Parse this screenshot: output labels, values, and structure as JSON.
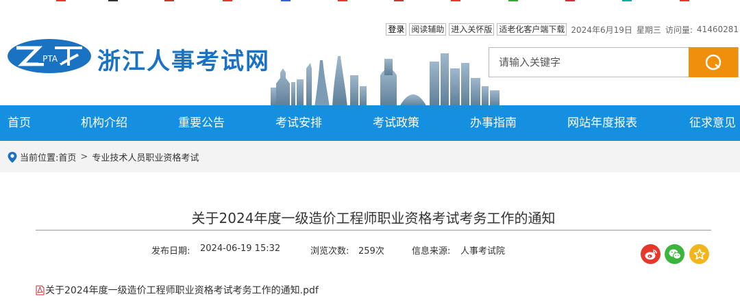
{
  "site": {
    "logo_text": "PTA",
    "title": "浙江人事考试网"
  },
  "toplinks": {
    "login": "登录",
    "reading_aid": "阅读辅助",
    "care_mode": "进入关怀版",
    "elderly_download": "适老化客户端下载",
    "date": "2024年6月19日",
    "weekday": "星期三",
    "visits_label": "访问量:",
    "visits": "41460281"
  },
  "search": {
    "placeholder": "请输入关键字",
    "icon": "search-icon"
  },
  "nav": {
    "items": [
      {
        "label": "首页"
      },
      {
        "label": "机构介绍"
      },
      {
        "label": "重要公告"
      },
      {
        "label": "考试安排"
      },
      {
        "label": "考试政策"
      },
      {
        "label": "办事指南"
      },
      {
        "label": "网站年度报表"
      },
      {
        "label": "征求意见"
      }
    ]
  },
  "breadcrumb": {
    "label": "当前位置:",
    "home": "首页",
    "separator": ">",
    "current": "专业技术人员职业资格考试"
  },
  "article": {
    "title": "关于2024年度一级造价工程师职业资格考试考务工作的通知",
    "date_label": "发布日期:",
    "date": "2024-06-19 15:32",
    "views_label": "浏览次数:",
    "views": "259次",
    "source_label": "信息来源:",
    "source": "人事考试院",
    "attachment": "关于2024年度一级造价工程师职业资格考试考务工作的通知.pdf"
  },
  "share": {
    "weibo": "weibo-icon",
    "wechat": "wechat-icon",
    "favorite": "star-icon"
  },
  "colors": {
    "brand_blue": "#1a72c2",
    "nav_blue": "#1590e0",
    "search_orange": "#f0900a",
    "weibo_red": "#e6372b",
    "wechat_green": "#3bb53b",
    "favorite_yellow": "#f2b51e"
  }
}
